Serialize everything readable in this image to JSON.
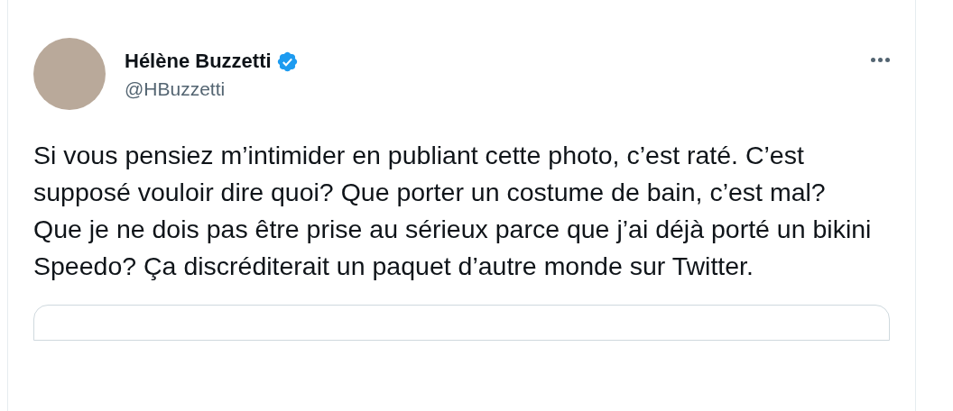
{
  "tweet": {
    "author": {
      "name": "Hélène Buzzetti",
      "verified": true,
      "handle": "@HBuzzetti"
    },
    "text": "Si vous pensiez m’intimider en publiant cette photo, c’est raté. C’est supposé vouloir dire quoi? Que porter un costume de bain, c’est mal? Que je ne dois pas être prise au sérieux parce que j’ai déjà porté un bikini Speedo? Ça discréditerait un paquet d’autre monde sur Twitter."
  }
}
